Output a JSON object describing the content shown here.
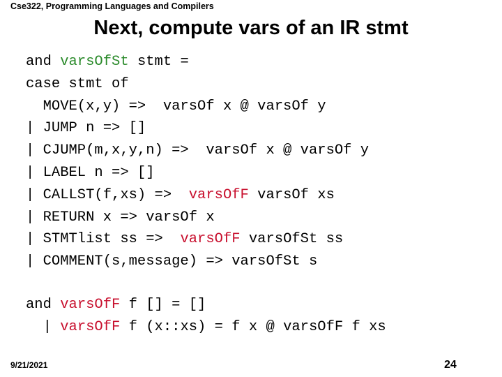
{
  "header": {
    "course": "Cse322, Programming Languages and Compilers"
  },
  "slide": {
    "title": "Next, compute vars of an IR stmt",
    "colors": {
      "green": "#2a8a2a",
      "red": "#c8102e"
    },
    "code_block_1": [
      [
        {
          "t": "and "
        },
        {
          "t": "varsOfSt",
          "c": "green"
        },
        {
          "t": " stmt ="
        }
      ],
      [
        {
          "t": "case stmt of"
        }
      ],
      [
        {
          "t": "  MOVE(x,y) =>  varsOf x @ varsOf y"
        }
      ],
      [
        {
          "t": "| JUMP n => []"
        }
      ],
      [
        {
          "t": "| CJUMP(m,x,y,n) =>  varsOf x @ varsOf y"
        }
      ],
      [
        {
          "t": "| LABEL n => []"
        }
      ],
      [
        {
          "t": "| CALLST(f,xs) =>  "
        },
        {
          "t": "varsOfF",
          "c": "red"
        },
        {
          "t": " varsOf xs"
        }
      ],
      [
        {
          "t": "| RETURN x => varsOf x"
        }
      ],
      [
        {
          "t": "| STMTlist ss =>  "
        },
        {
          "t": "varsOfF",
          "c": "red"
        },
        {
          "t": " varsOfSt ss"
        }
      ],
      [
        {
          "t": "| COMMENT(s,message) => varsOfSt s"
        }
      ]
    ],
    "code_block_2": [
      [
        {
          "t": "and "
        },
        {
          "t": "varsOfF",
          "c": "red"
        },
        {
          "t": " f [] = []"
        }
      ],
      [
        {
          "t": "  | "
        },
        {
          "t": "varsOfF",
          "c": "red"
        },
        {
          "t": " f (x::xs) = f x @ varsOfF f xs"
        }
      ]
    ]
  },
  "footer": {
    "date": "9/21/2021",
    "page_number": "24"
  }
}
